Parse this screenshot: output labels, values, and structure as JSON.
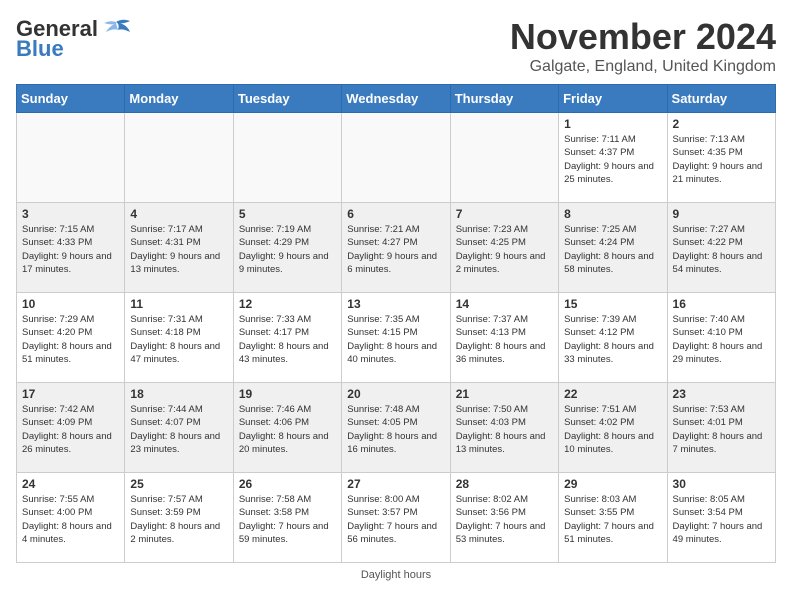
{
  "header": {
    "logo_general": "General",
    "logo_blue": "Blue",
    "month_title": "November 2024",
    "location": "Galgate, England, United Kingdom"
  },
  "weekdays": [
    "Sunday",
    "Monday",
    "Tuesday",
    "Wednesday",
    "Thursday",
    "Friday",
    "Saturday"
  ],
  "weeks": [
    [
      {
        "day": "",
        "info": ""
      },
      {
        "day": "",
        "info": ""
      },
      {
        "day": "",
        "info": ""
      },
      {
        "day": "",
        "info": ""
      },
      {
        "day": "",
        "info": ""
      },
      {
        "day": "1",
        "info": "Sunrise: 7:11 AM\nSunset: 4:37 PM\nDaylight: 9 hours and 25 minutes."
      },
      {
        "day": "2",
        "info": "Sunrise: 7:13 AM\nSunset: 4:35 PM\nDaylight: 9 hours and 21 minutes."
      }
    ],
    [
      {
        "day": "3",
        "info": "Sunrise: 7:15 AM\nSunset: 4:33 PM\nDaylight: 9 hours and 17 minutes."
      },
      {
        "day": "4",
        "info": "Sunrise: 7:17 AM\nSunset: 4:31 PM\nDaylight: 9 hours and 13 minutes."
      },
      {
        "day": "5",
        "info": "Sunrise: 7:19 AM\nSunset: 4:29 PM\nDaylight: 9 hours and 9 minutes."
      },
      {
        "day": "6",
        "info": "Sunrise: 7:21 AM\nSunset: 4:27 PM\nDaylight: 9 hours and 6 minutes."
      },
      {
        "day": "7",
        "info": "Sunrise: 7:23 AM\nSunset: 4:25 PM\nDaylight: 9 hours and 2 minutes."
      },
      {
        "day": "8",
        "info": "Sunrise: 7:25 AM\nSunset: 4:24 PM\nDaylight: 8 hours and 58 minutes."
      },
      {
        "day": "9",
        "info": "Sunrise: 7:27 AM\nSunset: 4:22 PM\nDaylight: 8 hours and 54 minutes."
      }
    ],
    [
      {
        "day": "10",
        "info": "Sunrise: 7:29 AM\nSunset: 4:20 PM\nDaylight: 8 hours and 51 minutes."
      },
      {
        "day": "11",
        "info": "Sunrise: 7:31 AM\nSunset: 4:18 PM\nDaylight: 8 hours and 47 minutes."
      },
      {
        "day": "12",
        "info": "Sunrise: 7:33 AM\nSunset: 4:17 PM\nDaylight: 8 hours and 43 minutes."
      },
      {
        "day": "13",
        "info": "Sunrise: 7:35 AM\nSunset: 4:15 PM\nDaylight: 8 hours and 40 minutes."
      },
      {
        "day": "14",
        "info": "Sunrise: 7:37 AM\nSunset: 4:13 PM\nDaylight: 8 hours and 36 minutes."
      },
      {
        "day": "15",
        "info": "Sunrise: 7:39 AM\nSunset: 4:12 PM\nDaylight: 8 hours and 33 minutes."
      },
      {
        "day": "16",
        "info": "Sunrise: 7:40 AM\nSunset: 4:10 PM\nDaylight: 8 hours and 29 minutes."
      }
    ],
    [
      {
        "day": "17",
        "info": "Sunrise: 7:42 AM\nSunset: 4:09 PM\nDaylight: 8 hours and 26 minutes."
      },
      {
        "day": "18",
        "info": "Sunrise: 7:44 AM\nSunset: 4:07 PM\nDaylight: 8 hours and 23 minutes."
      },
      {
        "day": "19",
        "info": "Sunrise: 7:46 AM\nSunset: 4:06 PM\nDaylight: 8 hours and 20 minutes."
      },
      {
        "day": "20",
        "info": "Sunrise: 7:48 AM\nSunset: 4:05 PM\nDaylight: 8 hours and 16 minutes."
      },
      {
        "day": "21",
        "info": "Sunrise: 7:50 AM\nSunset: 4:03 PM\nDaylight: 8 hours and 13 minutes."
      },
      {
        "day": "22",
        "info": "Sunrise: 7:51 AM\nSunset: 4:02 PM\nDaylight: 8 hours and 10 minutes."
      },
      {
        "day": "23",
        "info": "Sunrise: 7:53 AM\nSunset: 4:01 PM\nDaylight: 8 hours and 7 minutes."
      }
    ],
    [
      {
        "day": "24",
        "info": "Sunrise: 7:55 AM\nSunset: 4:00 PM\nDaylight: 8 hours and 4 minutes."
      },
      {
        "day": "25",
        "info": "Sunrise: 7:57 AM\nSunset: 3:59 PM\nDaylight: 8 hours and 2 minutes."
      },
      {
        "day": "26",
        "info": "Sunrise: 7:58 AM\nSunset: 3:58 PM\nDaylight: 7 hours and 59 minutes."
      },
      {
        "day": "27",
        "info": "Sunrise: 8:00 AM\nSunset: 3:57 PM\nDaylight: 7 hours and 56 minutes."
      },
      {
        "day": "28",
        "info": "Sunrise: 8:02 AM\nSunset: 3:56 PM\nDaylight: 7 hours and 53 minutes."
      },
      {
        "day": "29",
        "info": "Sunrise: 8:03 AM\nSunset: 3:55 PM\nDaylight: 7 hours and 51 minutes."
      },
      {
        "day": "30",
        "info": "Sunrise: 8:05 AM\nSunset: 3:54 PM\nDaylight: 7 hours and 49 minutes."
      }
    ]
  ],
  "footer": "Daylight hours"
}
